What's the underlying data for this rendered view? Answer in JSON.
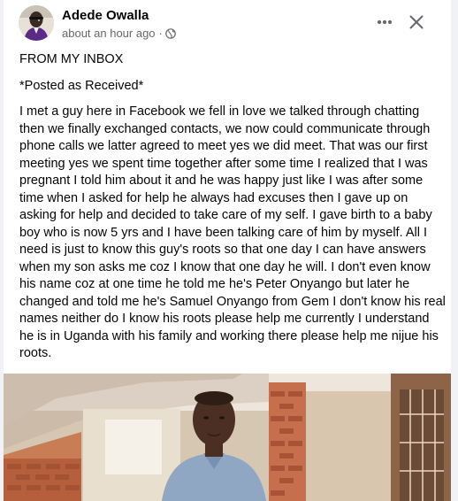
{
  "post": {
    "author_name": "Adede Owalla",
    "timestamp": "about an hour ago",
    "meta_separator": "·",
    "audience_icon": "globe-icon",
    "actions": {
      "more_icon": "more-horizontal-icon",
      "close_icon": "close-icon"
    },
    "body": {
      "line1": "FROM MY INBOX",
      "line2": "*Posted as Received*",
      "main": "I met a guy here in Facebook we fell in love we talked through chatting then we finally exchanged contacts, we now could communicate through phone calls we latter agreed to meet yes we did meet. That was our first meeting yes we spent time together after some time I realized that I was pregnant I told him about it and he was happy just like I was after some time when I asked for help he always had excuses then I gave up on asking for help and decided to take care of my self. I gave birth to a baby boy who is now 5 yrs and I have been talking care of him by myself. All I need is just to know this guy's roots so that one day I can have answers when my son asks me coz I know that one day he will. I don't even know his name coz at one time he told me he's Peter Onyango but later he changed and told me he's Samuel Onyango from Gem I don't know his real names neither do I know his roots please help me currently I understand he is in Uganda with his family and working there please help me nijue his roots."
    }
  },
  "colors": {
    "page_background": "#f0f2f5",
    "card_background": "#ffffff",
    "primary_text": "#050505",
    "secondary_text": "#65676b"
  }
}
